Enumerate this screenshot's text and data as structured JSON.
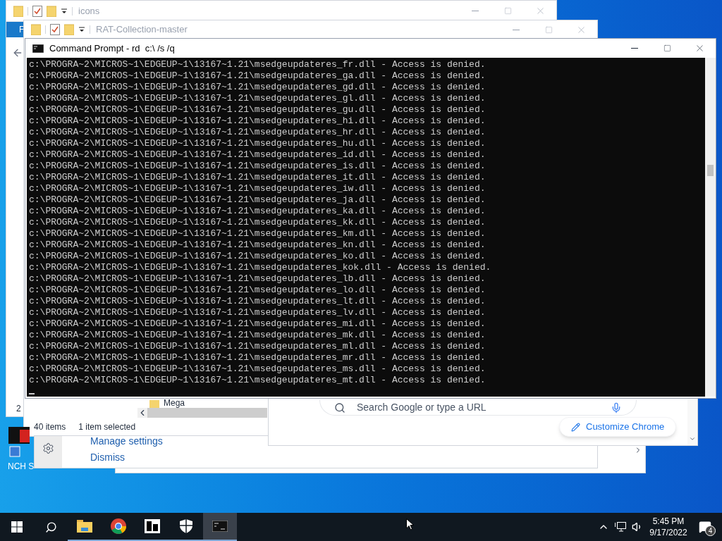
{
  "explorer_windows": [
    {
      "title": "icons",
      "ribbon_tab": "F",
      "status": "2"
    },
    {
      "title": "RAT-Collection-master",
      "folder": "Mega",
      "item_count": "40 items",
      "selection": "1 item selected"
    }
  ],
  "notification": {
    "links": [
      "Manage settings",
      "Dismiss"
    ]
  },
  "chrome": {
    "search_placeholder": "Search Google or type a URL",
    "customize": "Customize Chrome"
  },
  "console": {
    "title": "Command Prompt - rd  c:\\ /s /q",
    "lines": [
      "c:\\PROGRA~2\\MICROS~1\\EDGEUP~1\\13167~1.21\\msedgeupdateres_fr.dll - Access is denied.",
      "c:\\PROGRA~2\\MICROS~1\\EDGEUP~1\\13167~1.21\\msedgeupdateres_ga.dll - Access is denied.",
      "c:\\PROGRA~2\\MICROS~1\\EDGEUP~1\\13167~1.21\\msedgeupdateres_gd.dll - Access is denied.",
      "c:\\PROGRA~2\\MICROS~1\\EDGEUP~1\\13167~1.21\\msedgeupdateres_gl.dll - Access is denied.",
      "c:\\PROGRA~2\\MICROS~1\\EDGEUP~1\\13167~1.21\\msedgeupdateres_gu.dll - Access is denied.",
      "c:\\PROGRA~2\\MICROS~1\\EDGEUP~1\\13167~1.21\\msedgeupdateres_hi.dll - Access is denied.",
      "c:\\PROGRA~2\\MICROS~1\\EDGEUP~1\\13167~1.21\\msedgeupdateres_hr.dll - Access is denied.",
      "c:\\PROGRA~2\\MICROS~1\\EDGEUP~1\\13167~1.21\\msedgeupdateres_hu.dll - Access is denied.",
      "c:\\PROGRA~2\\MICROS~1\\EDGEUP~1\\13167~1.21\\msedgeupdateres_id.dll - Access is denied.",
      "c:\\PROGRA~2\\MICROS~1\\EDGEUP~1\\13167~1.21\\msedgeupdateres_is.dll - Access is denied.",
      "c:\\PROGRA~2\\MICROS~1\\EDGEUP~1\\13167~1.21\\msedgeupdateres_it.dll - Access is denied.",
      "c:\\PROGRA~2\\MICROS~1\\EDGEUP~1\\13167~1.21\\msedgeupdateres_iw.dll - Access is denied.",
      "c:\\PROGRA~2\\MICROS~1\\EDGEUP~1\\13167~1.21\\msedgeupdateres_ja.dll - Access is denied.",
      "c:\\PROGRA~2\\MICROS~1\\EDGEUP~1\\13167~1.21\\msedgeupdateres_ka.dll - Access is denied.",
      "c:\\PROGRA~2\\MICROS~1\\EDGEUP~1\\13167~1.21\\msedgeupdateres_kk.dll - Access is denied.",
      "c:\\PROGRA~2\\MICROS~1\\EDGEUP~1\\13167~1.21\\msedgeupdateres_km.dll - Access is denied.",
      "c:\\PROGRA~2\\MICROS~1\\EDGEUP~1\\13167~1.21\\msedgeupdateres_kn.dll - Access is denied.",
      "c:\\PROGRA~2\\MICROS~1\\EDGEUP~1\\13167~1.21\\msedgeupdateres_ko.dll - Access is denied.",
      "c:\\PROGRA~2\\MICROS~1\\EDGEUP~1\\13167~1.21\\msedgeupdateres_kok.dll - Access is denied.",
      "c:\\PROGRA~2\\MICROS~1\\EDGEUP~1\\13167~1.21\\msedgeupdateres_lb.dll - Access is denied.",
      "c:\\PROGRA~2\\MICROS~1\\EDGEUP~1\\13167~1.21\\msedgeupdateres_lo.dll - Access is denied.",
      "c:\\PROGRA~2\\MICROS~1\\EDGEUP~1\\13167~1.21\\msedgeupdateres_lt.dll - Access is denied.",
      "c:\\PROGRA~2\\MICROS~1\\EDGEUP~1\\13167~1.21\\msedgeupdateres_lv.dll - Access is denied.",
      "c:\\PROGRA~2\\MICROS~1\\EDGEUP~1\\13167~1.21\\msedgeupdateres_mi.dll - Access is denied.",
      "c:\\PROGRA~2\\MICROS~1\\EDGEUP~1\\13167~1.21\\msedgeupdateres_mk.dll - Access is denied.",
      "c:\\PROGRA~2\\MICROS~1\\EDGEUP~1\\13167~1.21\\msedgeupdateres_ml.dll - Access is denied.",
      "c:\\PROGRA~2\\MICROS~1\\EDGEUP~1\\13167~1.21\\msedgeupdateres_mr.dll - Access is denied.",
      "c:\\PROGRA~2\\MICROS~1\\EDGEUP~1\\13167~1.21\\msedgeupdateres_ms.dll - Access is denied.",
      "c:\\PROGRA~2\\MICROS~1\\EDGEUP~1\\13167~1.21\\msedgeupdateres_mt.dll - Access is denied."
    ]
  },
  "desktop_icons": [
    {
      "label": "NCH S"
    }
  ],
  "taskbar": {
    "apps": [
      {
        "kind": "explorer",
        "selected": false
      },
      {
        "kind": "chrome",
        "selected": false
      },
      {
        "kind": "archiver",
        "selected": false
      },
      {
        "kind": "security",
        "selected": false
      },
      {
        "kind": "console",
        "selected": true
      }
    ],
    "time": "5:45 PM",
    "date": "9/17/2022",
    "notification_count": "4"
  }
}
